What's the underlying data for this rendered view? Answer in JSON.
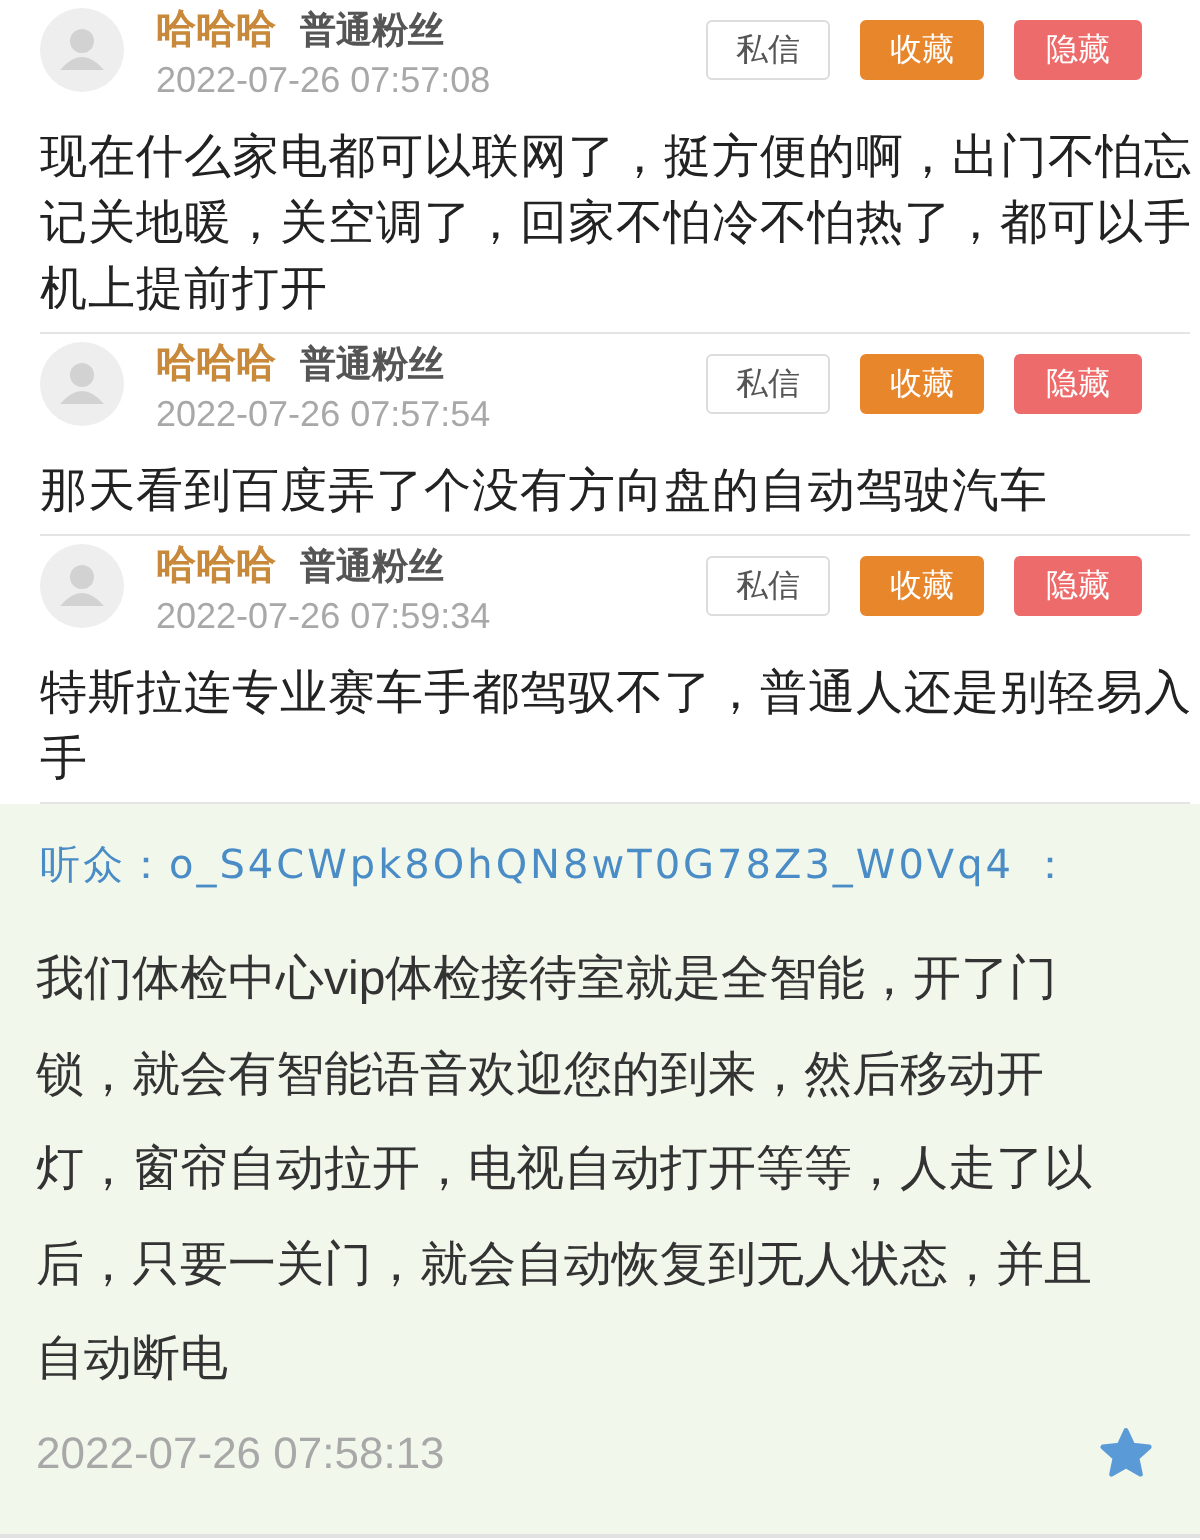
{
  "comments": [
    {
      "user": "哈哈哈",
      "rank": "普通粉丝",
      "time": "2022-07-26 07:57:08",
      "buttons": [
        {
          "label": "私信",
          "kind": "message"
        },
        {
          "label": "收藏",
          "kind": "favorite"
        },
        {
          "label": "隐藏",
          "kind": "hide"
        }
      ],
      "text": "现在什么家电都可以联网了，挺方便的啊，出门不怕忘记关地暖，关空调了，回家不怕冷不怕热了，都可以手机上提前打开"
    },
    {
      "user": "哈哈哈",
      "rank": "普通粉丝",
      "time": "2022-07-26 07:57:54",
      "buttons": [
        {
          "label": "私信",
          "kind": "message"
        },
        {
          "label": "收藏",
          "kind": "favorite"
        },
        {
          "label": "隐藏",
          "kind": "hide"
        }
      ],
      "text": "那天看到百度弄了个没有方向盘的自动驾驶汽车"
    },
    {
      "user": "哈哈哈",
      "rank": "普通粉丝",
      "time": "2022-07-26 07:59:34",
      "buttons": [
        {
          "label": "私信",
          "kind": "message"
        },
        {
          "label": "收藏",
          "kind": "favorite"
        },
        {
          "label": "隐藏",
          "kind": "hide"
        }
      ],
      "text": "特斯拉连专业赛车手都驾驭不了，普通人还是别轻易入手"
    }
  ],
  "listener_comment": {
    "author": "听众：o_S4CWpk8OhQN8wT0G78Z3_W0Vq4 ：",
    "text": "我们体检中心vip体检接待室就是全智能，开了门锁，就会有智能语音欢迎您的到来，然后移动开灯，窗帘自动拉开，电视自动打开等等，人走了以后，只要一关门，就会自动恢复到无人状态，并且自动断电",
    "time": "2022-07-26 07:58:13"
  }
}
